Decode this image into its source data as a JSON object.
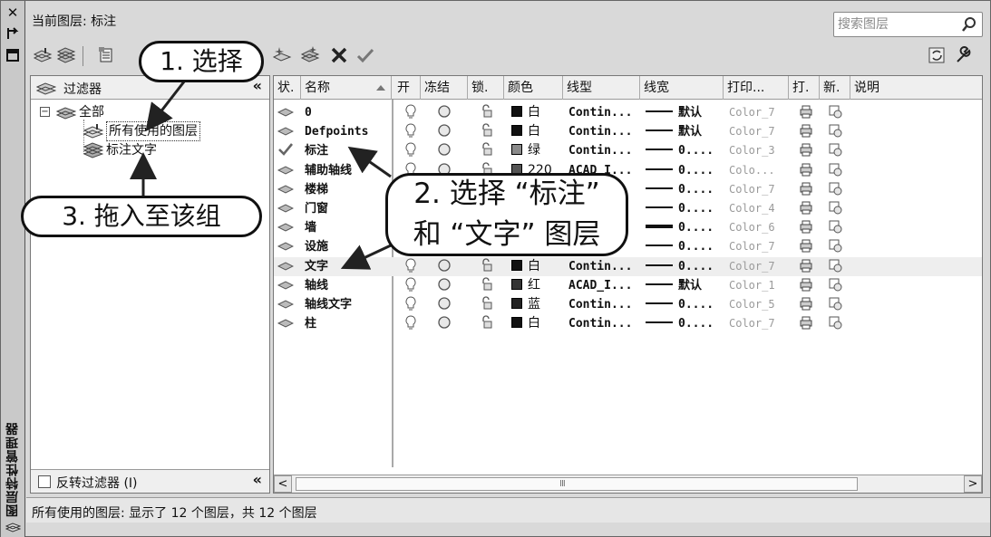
{
  "window": {
    "vertical_title": "图层特性管理器",
    "close_glyph": "✕"
  },
  "header": {
    "current_layer": "当前图层: 标注",
    "search_placeholder": "搜索图层"
  },
  "tree": {
    "header_label": "过滤器",
    "collapse_glyph": "«",
    "nodes": [
      {
        "label": "全部",
        "expander": "⊟"
      },
      {
        "label": "所有使用的图层"
      },
      {
        "label": "标注文字"
      }
    ],
    "invert_label": "反转过滤器 (I)"
  },
  "list": {
    "columns": [
      "状.",
      "名称",
      "开",
      "冻结",
      "锁.",
      "颜色",
      "线型",
      "线宽",
      "打印...",
      "打.",
      "新.",
      "说明"
    ],
    "rows": [
      {
        "name": "0",
        "color": "白",
        "swatch": "#111111",
        "linetype": "Contin...",
        "lineweight": "默认",
        "plotstyle": "Color_7",
        "current": false
      },
      {
        "name": "Defpoints",
        "color": "白",
        "swatch": "#111111",
        "linetype": "Contin...",
        "lineweight": "默认",
        "plotstyle": "Color_7",
        "current": false
      },
      {
        "name": "标注",
        "color": "绿",
        "swatch": "#8a8a8a",
        "linetype": "Contin...",
        "lineweight": "0....",
        "plotstyle": "Color_3",
        "current": true
      },
      {
        "name": "辅助轴线",
        "color": "220",
        "swatch": "#555555",
        "linetype": "ACAD_I...",
        "lineweight": "0....",
        "plotstyle": "Colo...",
        "current": false
      },
      {
        "name": "楼梯",
        "color": "",
        "swatch": "",
        "linetype": "",
        "lineweight": "0....",
        "plotstyle": "Color_7",
        "current": false
      },
      {
        "name": "门窗",
        "color": "",
        "swatch": "",
        "linetype": "",
        "lineweight": "0....",
        "plotstyle": "Color_4",
        "current": false
      },
      {
        "name": "墙",
        "color": "",
        "swatch": "",
        "linetype": "",
        "lineweight": "0....",
        "plotstyle": "Color_6",
        "current": false
      },
      {
        "name": "设施",
        "color": "",
        "swatch": "",
        "linetype": "",
        "lineweight": "0....",
        "plotstyle": "Color_7",
        "current": false
      },
      {
        "name": "文字",
        "color": "白",
        "swatch": "#111111",
        "linetype": "Contin...",
        "lineweight": "0....",
        "plotstyle": "Color_7",
        "current": false
      },
      {
        "name": "轴线",
        "color": "红",
        "swatch": "#333333",
        "linetype": "ACAD_I...",
        "lineweight": "默认",
        "plotstyle": "Color_1",
        "current": false
      },
      {
        "name": "轴线文字",
        "color": "蓝",
        "swatch": "#222222",
        "linetype": "Contin...",
        "lineweight": "0....",
        "plotstyle": "Color_5",
        "current": false
      },
      {
        "name": "柱",
        "color": "白",
        "swatch": "#111111",
        "linetype": "Contin...",
        "lineweight": "0....",
        "plotstyle": "Color_7",
        "current": false
      }
    ],
    "scroll_left": "<",
    "scroll_right": ">",
    "scroll_grip": "III"
  },
  "status": "所有使用的图层: 显示了 12 个图层，共 12 个图层",
  "callouts": {
    "step1": "1. 选择",
    "step2_line1": "2. 选择 “标注”",
    "step2_line2": "和 “文字” 图层",
    "step3": "3. 拖入至该组"
  }
}
